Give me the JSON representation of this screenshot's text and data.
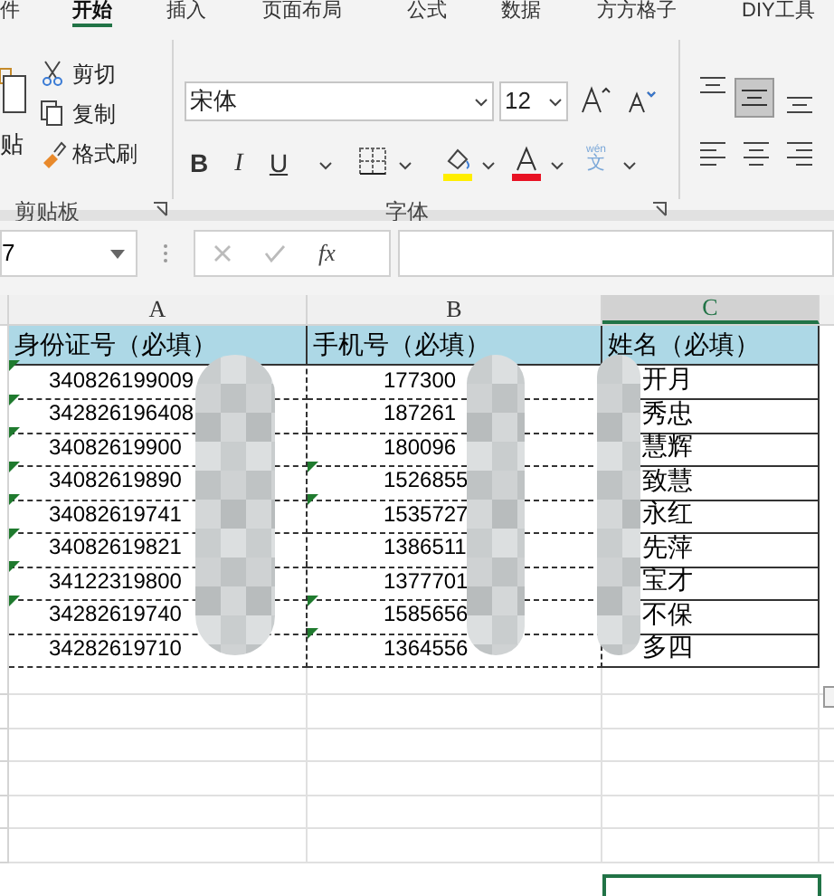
{
  "ribbon_tabs": [
    {
      "label": "件",
      "selected": false
    },
    {
      "label": "开始",
      "selected": true
    },
    {
      "label": "插入",
      "selected": false
    },
    {
      "label": "页面布局",
      "selected": false
    },
    {
      "label": "公式",
      "selected": false
    },
    {
      "label": "数据",
      "selected": false
    },
    {
      "label": "方方格子",
      "selected": false
    },
    {
      "label": "DIY工具",
      "selected": false
    }
  ],
  "clipboard": {
    "paste_label": "贴",
    "commands": [
      "剪切",
      "复制",
      "格式刷"
    ],
    "group_label": "剪贴板"
  },
  "font": {
    "name": "宋体",
    "size": "12",
    "style_buttons": [
      "B",
      "I",
      "U"
    ],
    "phonetic": "wén",
    "phonetic_glyph": "文",
    "group_label": "字体"
  },
  "formula_bar": {
    "name_box": "7",
    "function_label": "fx"
  },
  "columns": [
    {
      "label": "A",
      "selected": false
    },
    {
      "label": "B",
      "selected": false
    },
    {
      "label": "C",
      "selected": true
    }
  ],
  "header_row": [
    "身份证号（必填）",
    "手机号（必填）",
    "姓名（必填）"
  ],
  "rows": [
    {
      "cells": [
        {
          "text": "340826199009",
          "flag": true
        },
        {
          "text": "177300",
          "flag": false
        },
        {
          "text": "开月"
        }
      ]
    },
    {
      "cells": [
        {
          "text": "342826196408",
          "flag": true
        },
        {
          "text": "187261",
          "flag": false
        },
        {
          "text": "秀忠"
        }
      ]
    },
    {
      "cells": [
        {
          "text": "34082619900",
          "flag": true
        },
        {
          "text": "180096",
          "flag": false
        },
        {
          "text": "慧辉"
        }
      ]
    },
    {
      "cells": [
        {
          "text": "34082619890",
          "flag": true
        },
        {
          "text": "1526855",
          "flag": true
        },
        {
          "text": "致慧"
        }
      ]
    },
    {
      "cells": [
        {
          "text": "34082619741",
          "flag": true
        },
        {
          "text": "1535727",
          "flag": true
        },
        {
          "text": "永红"
        }
      ]
    },
    {
      "cells": [
        {
          "text": "34082619821",
          "flag": true
        },
        {
          "text": "1386511",
          "flag": false
        },
        {
          "text": "先萍"
        }
      ]
    },
    {
      "cells": [
        {
          "text": "34122319800",
          "flag": true
        },
        {
          "text": "1377701",
          "flag": false
        },
        {
          "text": "宝才"
        }
      ]
    },
    {
      "cells": [
        {
          "text": "34282619740",
          "flag": true
        },
        {
          "text": "1585656",
          "flag": true
        },
        {
          "text": "不保"
        }
      ]
    },
    {
      "cells": [
        {
          "text": "34282619710",
          "flag": false
        },
        {
          "text": "1364556",
          "flag": true
        },
        {
          "text": "多四"
        }
      ]
    }
  ]
}
